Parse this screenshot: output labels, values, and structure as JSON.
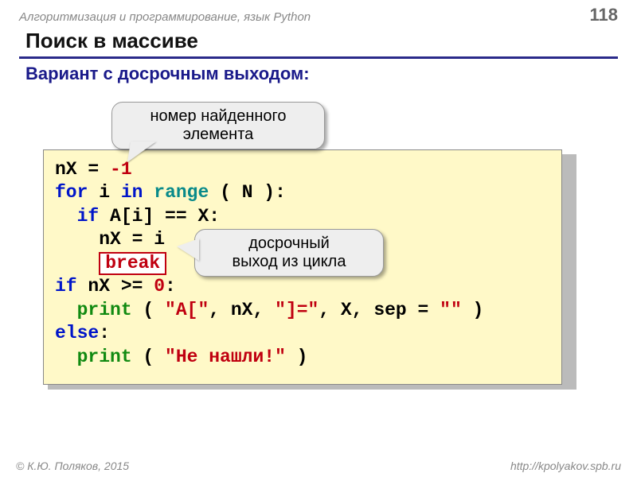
{
  "header": {
    "course": "Алгоритмизация и программирование, язык Python",
    "page": "118"
  },
  "title": "Поиск в массиве",
  "subtitle": "Вариант с досрочным выходом:",
  "callouts": {
    "found_index": "номер найденного элемента",
    "early_exit_l1": "досрочный",
    "early_exit_l2": "выход из цикла"
  },
  "code": {
    "l1_a": "nX = ",
    "l1_b": "-1",
    "l2_for": "for",
    "l2_mid": " i ",
    "l2_in": "in",
    "l2_sp": " ",
    "l2_range": "range",
    "l2_tail": " ( N ):",
    "l3_ind": "  ",
    "l3_if": "if",
    "l3_rest": " A[i] == X:",
    "l4_ind": "    ",
    "l4_txt": "nX = i",
    "l5_ind": "    ",
    "l5_break": "break",
    "l6_if": "if",
    "l6_mid": " nX >= ",
    "l6_zero": "0",
    "l6_colon": ":",
    "l7_ind": "  ",
    "l7_print": "print",
    "l7_sp": " ( ",
    "l7_s1": "\"A[\"",
    "l7_c1": ", nX, ",
    "l7_s2": "\"]=\"",
    "l7_c2": ", X, sep = ",
    "l7_s3": "\"\"",
    "l7_end": " )",
    "l8_else": "else",
    "l8_colon": ":",
    "l9_ind": "  ",
    "l9_print": "print",
    "l9_sp": " ( ",
    "l9_s": "\"Не нашли!\"",
    "l9_end": " )"
  },
  "footer": {
    "author": "© К.Ю. Поляков, 2015",
    "url": "http://kpolyakov.spb.ru"
  }
}
